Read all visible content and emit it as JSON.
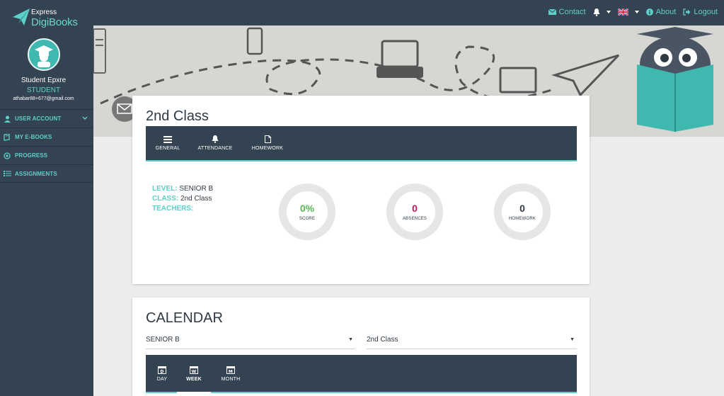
{
  "brand": {
    "line1": "Express",
    "line2": "DigiBooks"
  },
  "user": {
    "name": "Student Epxre",
    "role": "STUDENT",
    "email": "athabar88+677@gmail.com"
  },
  "nav": [
    {
      "label": "USER ACCOUNT",
      "icon": "user-icon"
    },
    {
      "label": "MY E-BOOKS",
      "icon": "book-icon"
    },
    {
      "label": "PROGRESS",
      "icon": "progress-icon"
    },
    {
      "label": "ASSIGNMENTS",
      "icon": "list-icon"
    }
  ],
  "topbar": {
    "contact": "Contact",
    "about": "About",
    "logout": "Logout"
  },
  "class_card": {
    "title": "2nd Class",
    "tabs": [
      "GENERAL",
      "ATTENDANCE",
      "HOMEWORK"
    ],
    "level_label": "LEVEL:",
    "level_value": "SENIOR B",
    "class_label": "CLASS:",
    "class_value": "2nd Class",
    "teachers_label": "TEACHERS:",
    "stats": [
      {
        "value": "0%",
        "label": "SCORE",
        "color": "#5cb85c"
      },
      {
        "value": "0",
        "label": "ABSENCES",
        "color": "#c2185b"
      },
      {
        "value": "0",
        "label": "HOMEWORK",
        "color": "#2f3a44"
      }
    ]
  },
  "calendar": {
    "title": "CALENDAR",
    "level_select": "SENIOR B",
    "class_select": "2nd Class",
    "tabs": [
      "DAY",
      "WEEK",
      "MONTH"
    ]
  },
  "colors": {
    "navy": "#344352",
    "teal": "#5ecfc9"
  }
}
